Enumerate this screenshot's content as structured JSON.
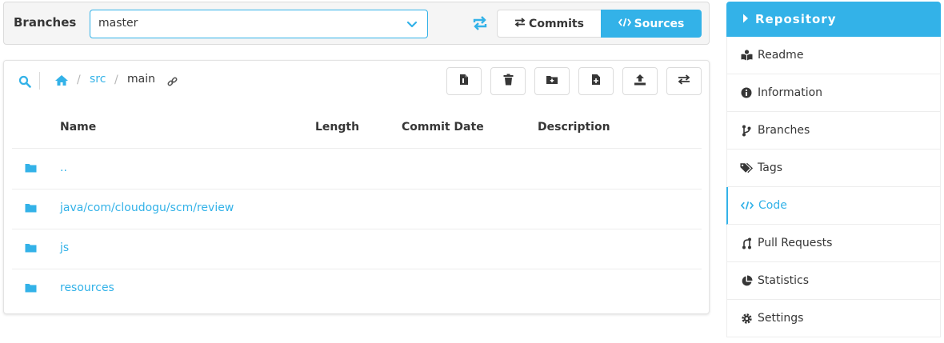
{
  "branch_bar": {
    "label": "Branches",
    "selected_branch": "master",
    "commits_label": "Commits",
    "sources_label": "Sources"
  },
  "breadcrumb": {
    "separator": "/",
    "items": [
      "src",
      "main"
    ]
  },
  "table": {
    "headers": [
      "Name",
      "Length",
      "Commit Date",
      "Description"
    ],
    "rows": [
      {
        "name": ".."
      },
      {
        "name": "java/com/cloudogu/scm/review"
      },
      {
        "name": "js"
      },
      {
        "name": "resources"
      }
    ]
  },
  "sidebar": {
    "title": "Repository",
    "items": [
      {
        "label": "Readme",
        "icon": "book-icon"
      },
      {
        "label": "Information",
        "icon": "info-icon"
      },
      {
        "label": "Branches",
        "icon": "branch-icon"
      },
      {
        "label": "Tags",
        "icon": "tags-icon"
      },
      {
        "label": "Code",
        "icon": "code-icon",
        "active": true
      },
      {
        "label": "Pull Requests",
        "icon": "pull-request-icon"
      },
      {
        "label": "Statistics",
        "icon": "chart-pie-icon"
      },
      {
        "label": "Settings",
        "icon": "cog-icon"
      }
    ]
  },
  "colors": {
    "accent": "#33b2e8",
    "text": "#363636",
    "border": "#dbdbdb"
  }
}
